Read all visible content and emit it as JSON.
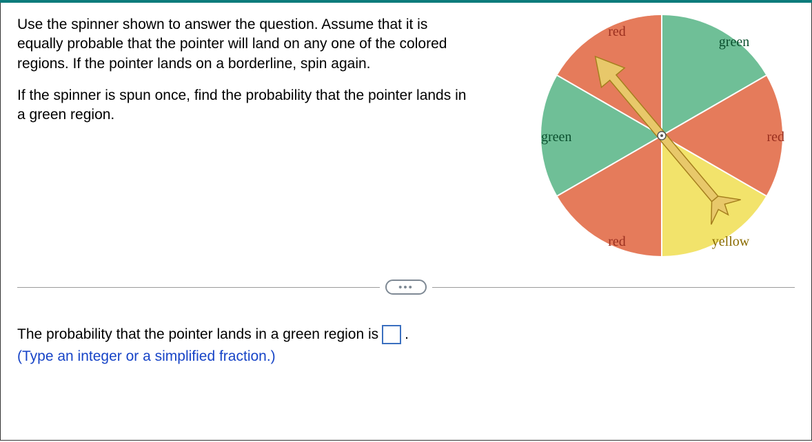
{
  "question": {
    "intro": "Use the spinner shown to answer the question.  Assume that it is equally probable that the pointer will land on any one of the colored regions.  If the pointer lands on a borderline, spin again.",
    "prompt": "If the spinner is spun once, find the probability that the pointer lands in a green region."
  },
  "answer": {
    "lead": "The probability that the pointer lands in a green region is",
    "period": ".",
    "hint": "(Type an integer or a simplified fraction.)",
    "value": ""
  },
  "divider": {
    "pill": "•••"
  },
  "spinner": {
    "labels": {
      "top_left": "red",
      "top_right": "green",
      "mid_left": "green",
      "mid_right": "red",
      "bot_left": "red",
      "bot_right": "yellow"
    },
    "colors": {
      "green": "#6fbf97",
      "red": "#e57b5b",
      "yellow": "#f2e36b",
      "label_red": "#9a2f1f",
      "label_green": "#0a4f2e",
      "label_yellow": "#8a6b00",
      "arrow_fill": "#d8b24a",
      "arrow_stroke": "#a57f1e"
    }
  },
  "chart_data": {
    "type": "pie",
    "title": "Spinner regions",
    "categories": [
      "red",
      "green",
      "green",
      "red",
      "yellow",
      "red"
    ],
    "values": [
      1,
      1,
      1,
      1,
      1,
      1
    ],
    "series": [
      {
        "name": "red",
        "values": [
          3
        ]
      },
      {
        "name": "green",
        "values": [
          2
        ]
      },
      {
        "name": "yellow",
        "values": [
          1
        ]
      }
    ]
  }
}
